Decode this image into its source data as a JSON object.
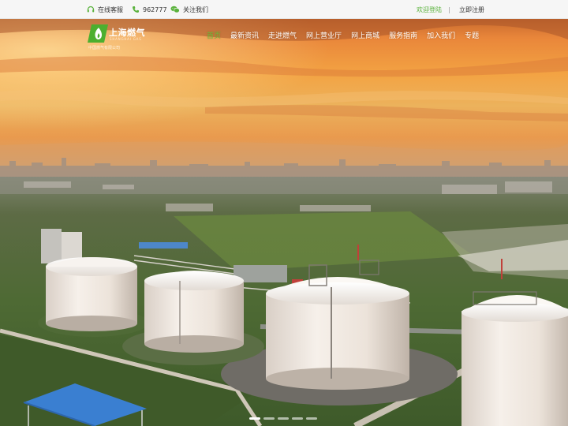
{
  "topbar": {
    "service_label": "在线客服",
    "phone_label": "962777",
    "follow_label": "关注我们",
    "login_label": "欢迎登陆",
    "separator": "|",
    "register_label": "立即注册"
  },
  "logo": {
    "title": "上海燃气",
    "english": "SHANGHAI GAS",
    "subtitle": "中国燃气有限公司"
  },
  "nav": {
    "items": [
      {
        "label": "首页",
        "active": true
      },
      {
        "label": "最新资讯",
        "active": false
      },
      {
        "label": "走进燃气",
        "active": false
      },
      {
        "label": "网上营业厅",
        "active": false
      },
      {
        "label": "网上商城",
        "active": false
      },
      {
        "label": "服务指南",
        "active": false
      },
      {
        "label": "加入我们",
        "active": false
      },
      {
        "label": "专题",
        "active": false
      }
    ]
  },
  "carousel": {
    "slide_count": 5,
    "active_index": 0
  },
  "colors": {
    "brand_green": "#5ab23c",
    "active_nav": "#67c23a",
    "sky_top": "#e9863a",
    "sky_mid": "#f6ad46",
    "horizon": "#e99a4e",
    "tank": "#f1ebe4"
  }
}
